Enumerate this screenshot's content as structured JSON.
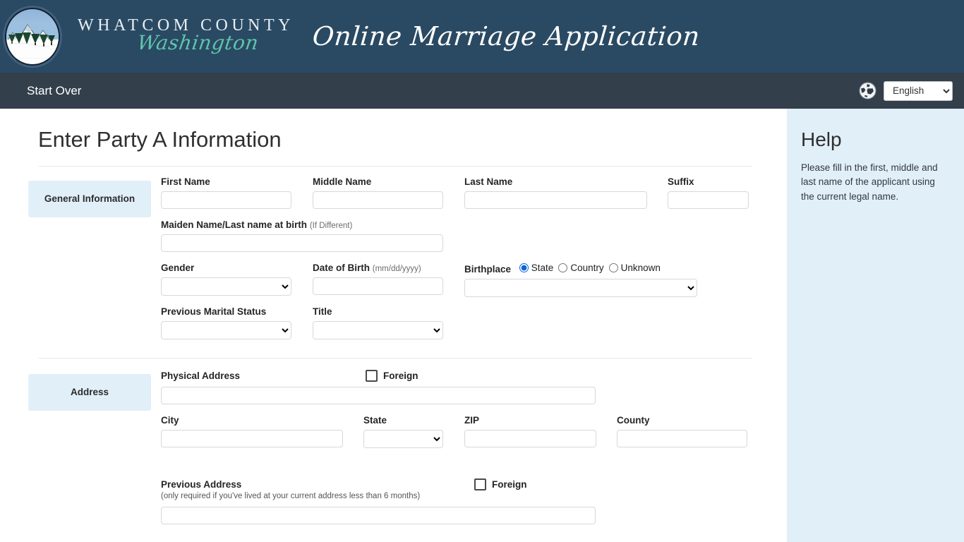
{
  "header": {
    "county_name": "WHATCOM COUNTY",
    "county_state": "Washington",
    "app_title": "Online Marriage Application",
    "logo_icon": "mountain-seal-logo"
  },
  "navbar": {
    "start_over_label": "Start Over",
    "globe_icon": "globe-icon",
    "language_selected": "English",
    "language_options": [
      "English"
    ]
  },
  "main": {
    "page_title": "Enter Party A Information",
    "sections": {
      "general": {
        "tag": "General Information",
        "first_name_label": "First Name",
        "first_name_value": "",
        "middle_name_label": "Middle Name",
        "middle_name_value": "",
        "last_name_label": "Last Name",
        "last_name_value": "",
        "suffix_label": "Suffix",
        "suffix_value": "",
        "maiden_name_label": "Maiden Name/Last name at birth",
        "maiden_name_hint": "(If Different)",
        "maiden_name_value": "",
        "gender_label": "Gender",
        "gender_value": "",
        "dob_label": "Date of Birth",
        "dob_hint": "(mm/dd/yyyy)",
        "dob_value": "",
        "birthplace_label": "Birthplace",
        "birthplace_options": [
          "State",
          "Country",
          "Unknown"
        ],
        "birthplace_selected": "State",
        "birthplace_value": "",
        "prev_marital_label": "Previous Marital Status",
        "prev_marital_value": "",
        "title_label": "Title",
        "title_value": ""
      },
      "address": {
        "tag": "Address",
        "physical_address_label": "Physical Address",
        "physical_address_value": "",
        "foreign_label": "Foreign",
        "foreign_checked": false,
        "city_label": "City",
        "city_value": "",
        "state_label": "State",
        "state_value": "",
        "zip_label": "ZIP",
        "zip_value": "",
        "county_label": "County",
        "county_value": "",
        "prev_address_label": "Previous Address",
        "prev_address_note": "(only required if you've lived at your current address less than 6 months)",
        "prev_address_value": "",
        "prev_foreign_label": "Foreign",
        "prev_foreign_checked": false
      }
    }
  },
  "sidebar": {
    "title": "Help",
    "text": "Please fill in the first, middle and last name of the applicant using the current legal name."
  },
  "colors": {
    "header_bg": "#2a4a63",
    "nav_bg": "#333f4b",
    "accent_teal": "#5fc4ac",
    "panel_blue": "#e1eff8",
    "radio_blue": "#0a65d8"
  }
}
